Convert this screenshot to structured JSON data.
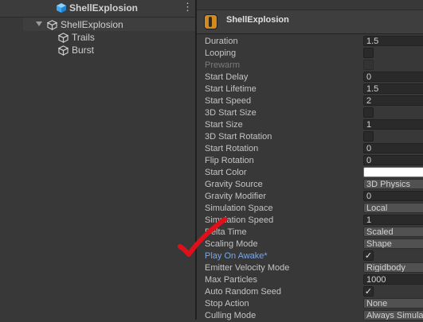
{
  "hierarchy": {
    "root": "ShellExplosion",
    "menu_icon": "⋮",
    "selected": "ShellExplosion",
    "children": [
      "Trails",
      "Burst"
    ]
  },
  "inspector": {
    "title": "ShellExplosion",
    "properties": [
      {
        "name": "Duration",
        "type": "number",
        "value": "1.5"
      },
      {
        "name": "Looping",
        "type": "checkbox",
        "checked": false
      },
      {
        "name": "Prewarm",
        "type": "checkbox",
        "checked": false,
        "disabled": true
      },
      {
        "name": "Start Delay",
        "type": "number",
        "value": "0"
      },
      {
        "name": "Start Lifetime",
        "type": "number",
        "value": "1.5"
      },
      {
        "name": "Start Speed",
        "type": "number",
        "value": "2"
      },
      {
        "name": "3D Start Size",
        "type": "checkbox",
        "checked": false
      },
      {
        "name": "Start Size",
        "type": "number",
        "value": "1"
      },
      {
        "name": "3D Start Rotation",
        "type": "checkbox",
        "checked": false
      },
      {
        "name": "Start Rotation",
        "type": "number",
        "value": "0"
      },
      {
        "name": "Flip Rotation",
        "type": "number",
        "value": "0"
      },
      {
        "name": "Start Color",
        "type": "color",
        "value": "#ffffff"
      },
      {
        "name": "Gravity Source",
        "type": "dropdown",
        "value": "3D Physics"
      },
      {
        "name": "Gravity Modifier",
        "type": "number",
        "value": "0"
      },
      {
        "name": "Simulation Space",
        "type": "dropdown",
        "value": "Local"
      },
      {
        "name": "Simulation Speed",
        "type": "number",
        "value": "1"
      },
      {
        "name": "Delta Time",
        "type": "dropdown",
        "value": "Scaled"
      },
      {
        "name": "Scaling Mode",
        "type": "dropdown",
        "value": "Shape"
      },
      {
        "name": "Play On Awake*",
        "type": "checkbox",
        "checked": true,
        "modified": true
      },
      {
        "name": "Emitter Velocity Mode",
        "type": "dropdown",
        "value": "Rigidbody"
      },
      {
        "name": "Max Particles",
        "type": "number",
        "value": "1000"
      },
      {
        "name": "Auto Random Seed",
        "type": "checkbox",
        "checked": true
      },
      {
        "name": "Stop Action",
        "type": "dropdown",
        "value": "None"
      },
      {
        "name": "Culling Mode",
        "type": "dropdown",
        "value": "Always Simulate"
      }
    ]
  },
  "annotation": {
    "mark": "red-checkmark",
    "color": "#e0101b"
  },
  "colors": {
    "panel_bg": "#383838",
    "modified_text": "#7aa7e8",
    "accent_orange": "#d28a1e"
  }
}
